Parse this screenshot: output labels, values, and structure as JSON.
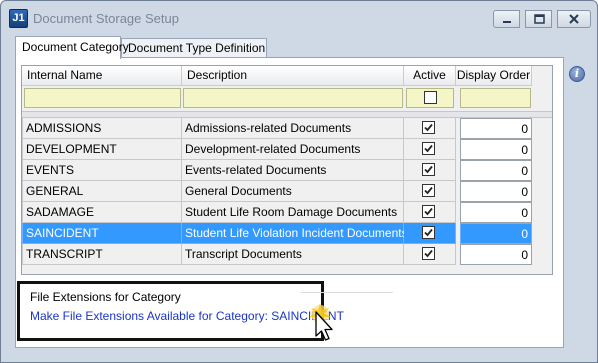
{
  "window": {
    "app_icon_text": "J1",
    "title": "Document Storage Setup"
  },
  "tabs": [
    {
      "label": "Document Category",
      "active": true
    },
    {
      "label": "Document Type Definition",
      "active": false
    }
  ],
  "grid": {
    "headers": {
      "name": "Internal Name",
      "description": "Description",
      "active": "Active",
      "order": "Display Order"
    },
    "rows": [
      {
        "name": "ADMISSIONS",
        "description": "Admissions-related Documents",
        "active": true,
        "order": "0"
      },
      {
        "name": "DEVELOPMENT",
        "description": "Development-related Documents",
        "active": true,
        "order": "0"
      },
      {
        "name": "EVENTS",
        "description": "Events-related Documents",
        "active": true,
        "order": "0"
      },
      {
        "name": "GENERAL",
        "description": "General Documents",
        "active": true,
        "order": "0"
      },
      {
        "name": "SADAMAGE",
        "description": "Student Life Room Damage Documents",
        "active": true,
        "order": "0"
      },
      {
        "name": "SAINCIDENT",
        "description": "Student Life Violation Incident Documents",
        "active": true,
        "order": "0"
      },
      {
        "name": "TRANSCRIPT",
        "description": "Transcript Documents",
        "active": true,
        "order": "0"
      }
    ],
    "selected_row": "SAINCIDENT"
  },
  "extensions": {
    "title": "File Extensions for Category",
    "link": "Make File Extensions Available for Category: SAINCIDENT"
  },
  "colors": {
    "selection": "#3399ff",
    "filter_row": "#f4f6c8",
    "link": "#1a35c8",
    "window_frame": "#cfd9e6"
  },
  "icons": [
    "app-icon",
    "minimize-icon",
    "maximize-icon",
    "close-icon",
    "info-icon",
    "checkbox-check-icon",
    "mouse-pointer-icon"
  ]
}
